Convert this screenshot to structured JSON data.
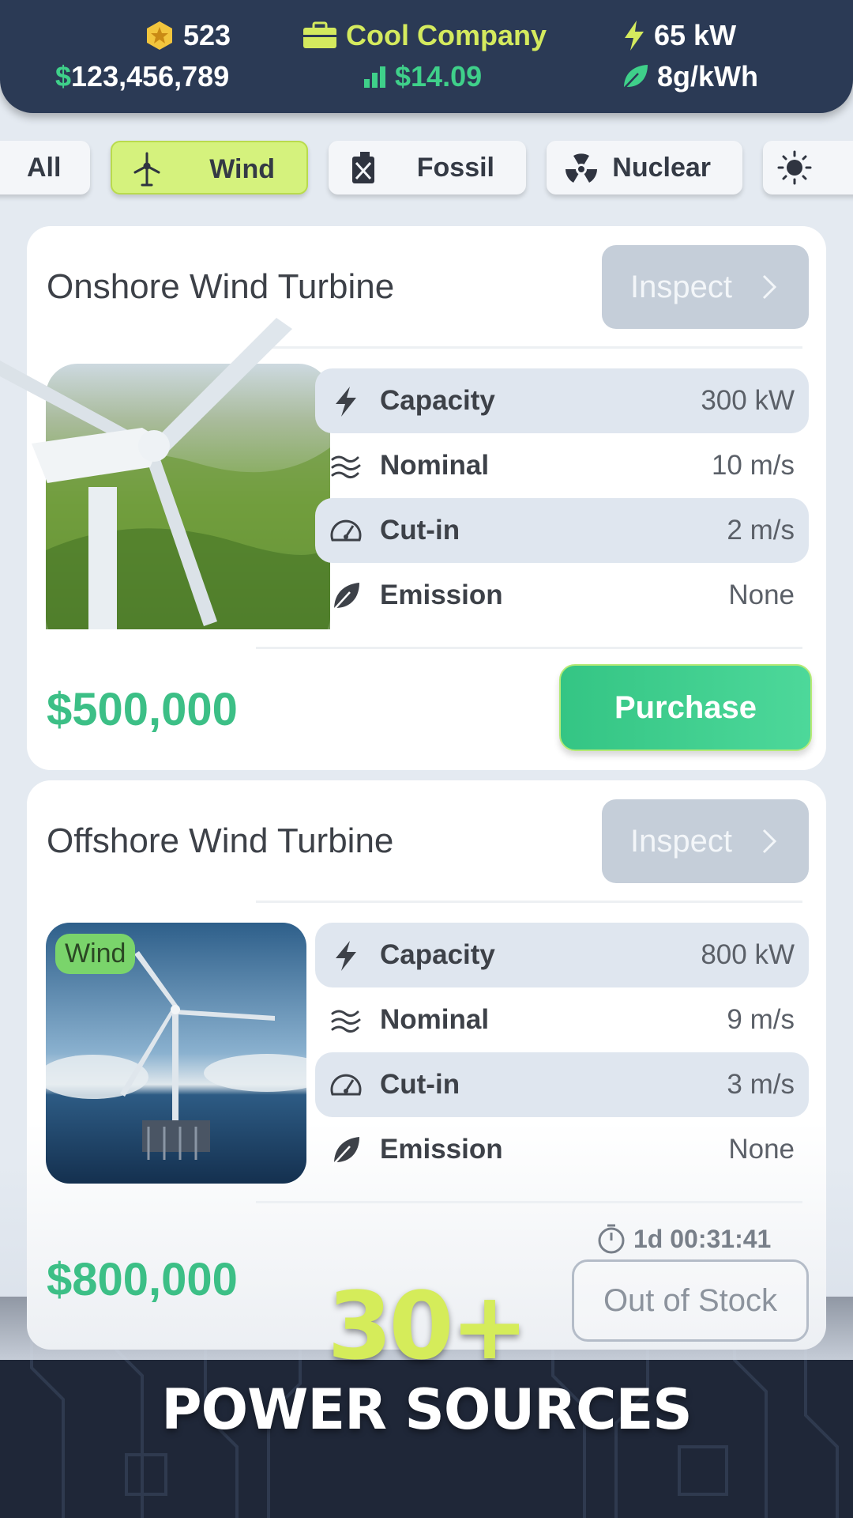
{
  "header": {
    "gems": "523",
    "money": "$123,456,789",
    "company": "Cool Company",
    "share_price": "$14.09",
    "power": "65 kW",
    "emission": "8g/kWh"
  },
  "filters": {
    "all": "All",
    "wind": "Wind",
    "fossil": "Fossil",
    "nuclear": "Nuclear"
  },
  "stat_labels": {
    "capacity": "Capacity",
    "nominal": "Nominal",
    "cutin": "Cut-in",
    "emission": "Emission"
  },
  "cards": [
    {
      "title": "Onshore Wind Turbine",
      "inspect": "Inspect",
      "capacity": "300 kW",
      "nominal": "10 m/s",
      "cutin": "2 m/s",
      "emission": "None",
      "price": "$500,000",
      "action": "Purchase"
    },
    {
      "title": "Offshore Wind Turbine",
      "inspect": "Inspect",
      "tag": "Wind",
      "capacity": "800 kW",
      "nominal": "9 m/s",
      "cutin": "3 m/s",
      "emission": "None",
      "price": "$800,000",
      "timer": "1d 00:31:41",
      "action": "Out of Stock"
    }
  ],
  "promo": {
    "count": "30+",
    "subtitle": "POWER SOURCES"
  },
  "colors": {
    "header_bg": "#2b3a55",
    "accent_green": "#3cbf86",
    "accent_yellow": "#d5ec5a",
    "chip_active": "#d5f27d"
  }
}
